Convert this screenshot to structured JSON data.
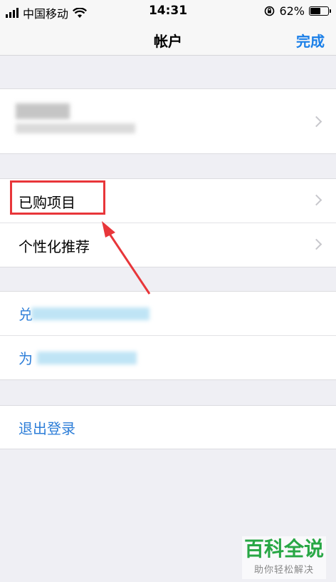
{
  "status_bar": {
    "carrier": "中国移动",
    "time": "14:31",
    "battery_percent": "62%",
    "battery_level": 0.62,
    "icons": [
      "signal-icon",
      "wifi-icon",
      "orientation-lock-icon",
      "battery-icon"
    ]
  },
  "nav": {
    "title": "帐户",
    "done_label": "完成",
    "accent_color": "#1a7fe8"
  },
  "groups": {
    "account": {
      "rows": [
        {
          "label": "",
          "obscured": true
        }
      ]
    },
    "store": {
      "rows": [
        {
          "label": "已购项目"
        },
        {
          "label": "个性化推荐"
        }
      ]
    },
    "links": {
      "rows": [
        {
          "label": "兑",
          "obscured": true
        },
        {
          "label": "为",
          "obscured": true
        }
      ]
    },
    "signout": {
      "rows": [
        {
          "label": "退出登录"
        }
      ]
    }
  },
  "annotation": {
    "highlight_color": "#e8363a"
  },
  "watermark": {
    "brand": "百科全说",
    "tagline": "助你轻松解决"
  }
}
